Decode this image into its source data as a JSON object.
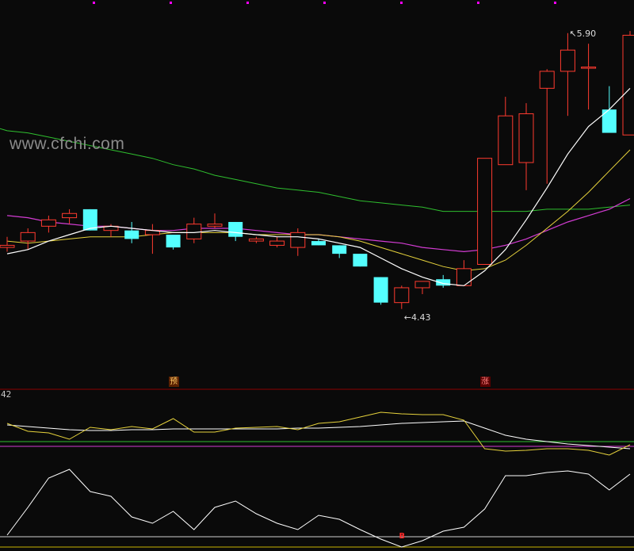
{
  "watermark": "www.cfchi.com",
  "indicator_panel_label": "42",
  "price_annotations": {
    "high_label": "5.90",
    "low_label": "4.43"
  },
  "badges": {
    "yu": {
      "label": "预",
      "bg": "#5a2000",
      "fg": "#ffcc66"
    },
    "zhang": {
      "label": "涨",
      "bg": "#5a0000",
      "fg": "#ff8080"
    },
    "b_marker": {
      "label": "B",
      "fg": "#ff2a2a"
    }
  },
  "colors": {
    "background": "#0a0a0a",
    "up_candle": "#ff3b2f",
    "down_candle": "#54ffff",
    "ma_white": "#ffffff",
    "ma_yellow": "#e6d23c",
    "ma_magenta": "#d23cd2",
    "ma_green": "#2fbf2f",
    "separator": "#8b0000",
    "top_dots": "#ff00ff"
  },
  "chart_data": [
    {
      "type": "candlestick",
      "title": "",
      "ylim": [
        4.3,
        6.0
      ],
      "max_label": "5.90",
      "min_label": "4.43",
      "candles": [
        {
          "o": 4.89,
          "h": 4.94,
          "l": 4.87,
          "c": 4.9
        },
        {
          "o": 4.92,
          "h": 4.98,
          "l": 4.88,
          "c": 4.96
        },
        {
          "o": 4.99,
          "h": 5.04,
          "l": 4.96,
          "c": 5.02
        },
        {
          "o": 5.03,
          "h": 5.07,
          "l": 5.0,
          "c": 5.05
        },
        {
          "o": 5.07,
          "h": 5.07,
          "l": 4.97,
          "c": 4.97
        },
        {
          "o": 4.97,
          "h": 5.0,
          "l": 4.94,
          "c": 4.99
        },
        {
          "o": 4.97,
          "h": 5.01,
          "l": 4.91,
          "c": 4.93
        },
        {
          "o": 4.95,
          "h": 5.0,
          "l": 4.86,
          "c": 4.97
        },
        {
          "o": 4.95,
          "h": 4.95,
          "l": 4.88,
          "c": 4.89
        },
        {
          "o": 4.93,
          "h": 5.03,
          "l": 4.91,
          "c": 5.0
        },
        {
          "o": 4.99,
          "h": 5.05,
          "l": 4.98,
          "c": 5.0
        },
        {
          "o": 5.01,
          "h": 5.01,
          "l": 4.92,
          "c": 4.94
        },
        {
          "o": 4.92,
          "h": 4.94,
          "l": 4.91,
          "c": 4.93
        },
        {
          "o": 4.9,
          "h": 4.94,
          "l": 4.89,
          "c": 4.92
        },
        {
          "o": 4.89,
          "h": 4.98,
          "l": 4.85,
          "c": 4.96
        },
        {
          "o": 4.92,
          "h": 4.93,
          "l": 4.9,
          "c": 4.9
        },
        {
          "o": 4.9,
          "h": 4.9,
          "l": 4.84,
          "c": 4.86
        },
        {
          "o": 4.86,
          "h": 4.86,
          "l": 4.8,
          "c": 4.8
        },
        {
          "o": 4.75,
          "h": 4.75,
          "l": 4.62,
          "c": 4.63
        },
        {
          "o": 4.63,
          "h": 4.71,
          "l": 4.6,
          "c": 4.7
        },
        {
          "o": 4.7,
          "h": 4.73,
          "l": 4.67,
          "c": 4.73
        },
        {
          "o": 4.74,
          "h": 4.76,
          "l": 4.7,
          "c": 4.71
        },
        {
          "o": 4.71,
          "h": 4.83,
          "l": 4.71,
          "c": 4.79
        },
        {
          "o": 4.81,
          "h": 5.31,
          "l": 4.81,
          "c": 5.31
        },
        {
          "o": 5.28,
          "h": 5.6,
          "l": 5.28,
          "c": 5.51
        },
        {
          "o": 5.29,
          "h": 5.57,
          "l": 5.16,
          "c": 5.52
        },
        {
          "o": 5.64,
          "h": 5.73,
          "l": 5.19,
          "c": 5.72
        },
        {
          "o": 5.72,
          "h": 5.9,
          "l": 5.51,
          "c": 5.82
        },
        {
          "o": 5.74,
          "h": 5.85,
          "l": 5.54,
          "c": 5.74
        },
        {
          "o": 5.54,
          "h": 5.65,
          "l": 5.45,
          "c": 5.43
        },
        {
          "o": 5.42,
          "h": 5.91,
          "l": 5.42,
          "c": 5.89
        }
      ],
      "ma_white": [
        4.86,
        4.88,
        4.92,
        4.95,
        4.98,
        4.99,
        4.98,
        4.97,
        4.96,
        4.96,
        4.97,
        4.96,
        4.95,
        4.94,
        4.94,
        4.93,
        4.91,
        4.89,
        4.84,
        4.79,
        4.75,
        4.72,
        4.71,
        4.78,
        4.88,
        5.02,
        5.17,
        5.33,
        5.46,
        5.54,
        5.64
      ],
      "ma_yellow": [
        4.92,
        4.91,
        4.92,
        4.93,
        4.94,
        4.94,
        4.94,
        4.95,
        4.96,
        4.96,
        4.96,
        4.96,
        4.95,
        4.95,
        4.95,
        4.95,
        4.94,
        4.92,
        4.89,
        4.86,
        4.83,
        4.8,
        4.78,
        4.79,
        4.83,
        4.9,
        4.98,
        5.06,
        5.15,
        5.25,
        5.35
      ],
      "ma_magenta": [
        5.04,
        5.03,
        5.01,
        5.0,
        4.99,
        4.99,
        4.98,
        4.97,
        4.97,
        4.98,
        4.98,
        4.98,
        4.97,
        4.96,
        4.95,
        4.95,
        4.94,
        4.93,
        4.92,
        4.91,
        4.89,
        4.88,
        4.87,
        4.88,
        4.9,
        4.93,
        4.97,
        5.01,
        5.04,
        5.07,
        5.12
      ],
      "ma_green": [
        5.44,
        5.43,
        5.41,
        5.39,
        5.37,
        5.35,
        5.33,
        5.31,
        5.28,
        5.26,
        5.23,
        5.21,
        5.19,
        5.17,
        5.16,
        5.15,
        5.13,
        5.11,
        5.1,
        5.09,
        5.08,
        5.06,
        5.06,
        5.06,
        5.06,
        5.06,
        5.07,
        5.07,
        5.07,
        5.08,
        5.09
      ]
    },
    {
      "type": "line",
      "title": "",
      "ylim": [
        0,
        100
      ],
      "reference_lines": [
        {
          "value": 43,
          "color": "#2fbf2f"
        },
        {
          "value": 37,
          "color": "#d23cd2"
        }
      ],
      "series": [
        {
          "color": "#ffffff",
          "values": [
            64,
            62,
            60,
            58,
            57,
            57,
            58,
            58,
            59,
            59,
            59,
            59,
            59,
            59,
            60,
            60,
            61,
            62,
            64,
            66,
            67,
            68,
            69,
            60,
            51,
            46,
            43,
            40,
            38,
            36,
            34
          ]
        },
        {
          "color": "#e6d23c",
          "values": [
            66,
            56,
            54,
            46,
            61,
            58,
            62,
            59,
            72,
            55,
            55,
            60,
            61,
            62,
            58,
            66,
            68,
            74,
            80,
            78,
            77,
            77,
            70,
            34,
            31,
            32,
            34,
            34,
            32,
            26,
            39
          ]
        }
      ]
    },
    {
      "type": "line",
      "title": "",
      "ylim": [
        0,
        100
      ],
      "series": [
        {
          "color": "#ffffff",
          "values": [
            15,
            50,
            87,
            98,
            70,
            64,
            38,
            30,
            45,
            22,
            50,
            58,
            42,
            30,
            22,
            40,
            35,
            22,
            10,
            0,
            8,
            20,
            25,
            48,
            90,
            90,
            94,
            96,
            92,
            72,
            92
          ]
        }
      ]
    }
  ]
}
